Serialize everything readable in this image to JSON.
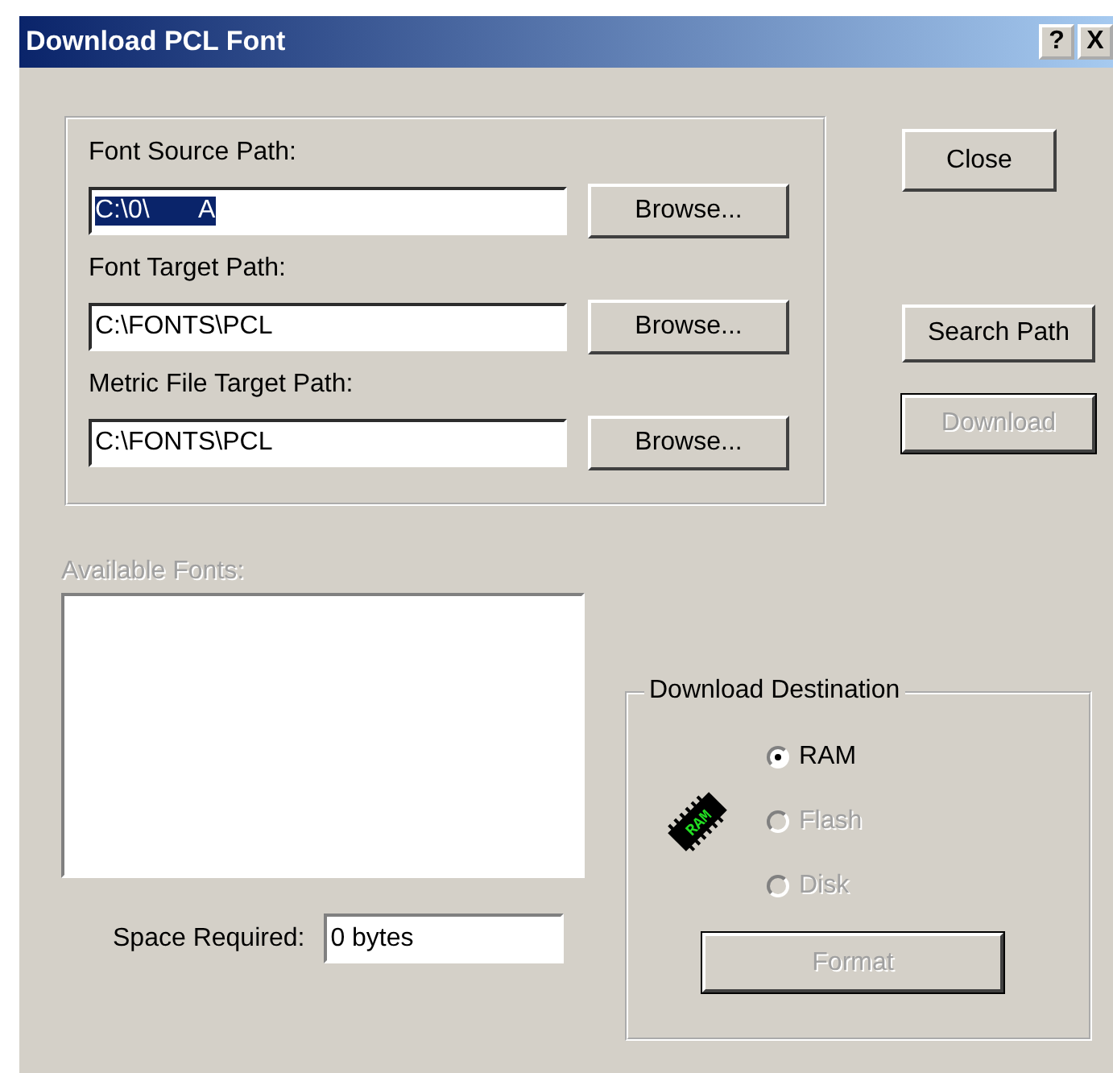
{
  "window": {
    "title": "Download PCL Font",
    "title_buttons": [
      "?",
      "X"
    ]
  },
  "paths": [
    {
      "label": "Font Source Path:",
      "value": "C:\\0\\       A",
      "selected": true,
      "button": "Browse..."
    },
    {
      "label": "Font Target Path:",
      "value": "C:\\FONTS\\PCL",
      "selected": false,
      "button": "Browse..."
    },
    {
      "label": "Metric File Target Path:",
      "value": "C:\\FONTS\\PCL",
      "selected": false,
      "button": "Browse..."
    }
  ],
  "side_buttons": [
    {
      "label": "Close",
      "disabled": false,
      "default": false
    },
    {
      "label": "Search Path",
      "disabled": false,
      "default": false
    },
    {
      "label": "Download",
      "disabled": true,
      "default": true
    }
  ],
  "available_fonts": {
    "label": "Available Fonts:",
    "disabled": true
  },
  "space_required": {
    "label": "Space Required:",
    "value": "0 bytes"
  },
  "destination": {
    "title": "Download Destination",
    "options": [
      {
        "label": "RAM",
        "selected": true,
        "disabled": false
      },
      {
        "label": "Flash",
        "selected": false,
        "disabled": true
      },
      {
        "label": "Disk",
        "selected": false,
        "disabled": true
      }
    ],
    "chip_label": "RAM",
    "button": {
      "label": "Format",
      "disabled": true,
      "default": true
    }
  }
}
